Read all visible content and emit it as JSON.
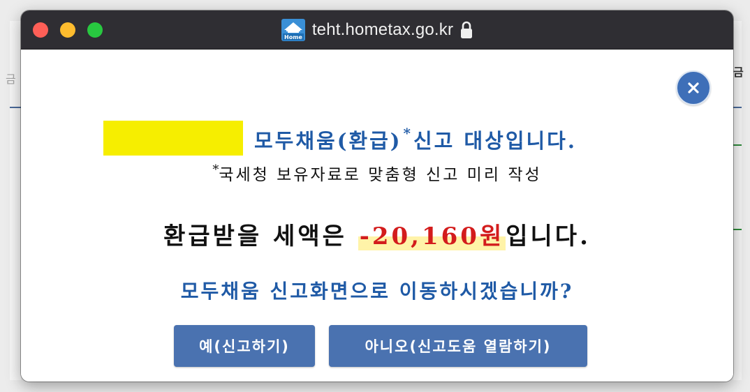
{
  "window": {
    "url": "teht.hometax.go.kr",
    "site_icon": "hometax-house-icon",
    "site_icon_label": "Home",
    "lock_icon": "lock-icon"
  },
  "background": {
    "left_fragment": "금",
    "right_fragment": "금"
  },
  "dialog": {
    "target_text": "모두채움(환급)",
    "target_asterisk": "*",
    "target_suffix": "신고 대상입니다.",
    "note_asterisk": "*",
    "note_text": "국세청 보유자료로 맞춤형 신고 미리 작성",
    "refund_prefix": "환급받을 세액은 ",
    "refund_amount": "-20,160원",
    "refund_suffix": "입니다.",
    "question": "모두채움 신고화면으로 이동하시겠습니까?",
    "yes_button": "예(신고하기)",
    "no_button": "아니오(신고도움 열람하기)",
    "close_button": "×"
  },
  "colors": {
    "titlebar": "#2f2e33",
    "accent_blue": "#1f5aa6",
    "button_blue": "#4a72b0",
    "amount_red": "#d31c1c",
    "name_mask_yellow": "#f6ee00",
    "amount_highlight": "#fff3a8"
  }
}
